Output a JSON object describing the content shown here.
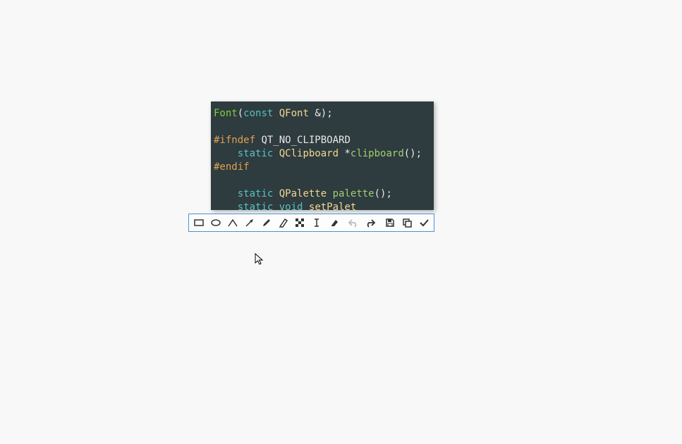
{
  "code": {
    "line1": {
      "a": "Font",
      "b": "(",
      "c": "const",
      "d": " ",
      "e": "QFont",
      "f": " &);"
    },
    "line2": "",
    "line3": {
      "a": "#ifndef",
      "b": " ",
      "c": "QT_NO_CLIPBOARD"
    },
    "line4": {
      "a": "    ",
      "b": "static",
      "c": " ",
      "d": "QClipboard",
      "e": " *",
      "f": "clipboard",
      "g": "();"
    },
    "line5": {
      "a": "#endif"
    },
    "line6": "",
    "line7": {
      "a": "    ",
      "b": "static",
      "c": " ",
      "d": "QPalette",
      "e": " ",
      "f": "palette",
      "g": "();"
    },
    "line8": {
      "a": "    ",
      "b": "static",
      "c": " ",
      "d": "void",
      "e": " ",
      "f": "setPalet"
    }
  },
  "toolbar": {
    "rect": "rectangle",
    "ellipse": "ellipse",
    "line": "line",
    "arrow": "arrow",
    "pencil": "pencil",
    "marker": "marker",
    "pixelate": "pixelate",
    "text": "text",
    "eraser": "eraser",
    "undo": "undo",
    "redo": "redo",
    "save": "save",
    "copy": "copy",
    "ok": "ok"
  }
}
